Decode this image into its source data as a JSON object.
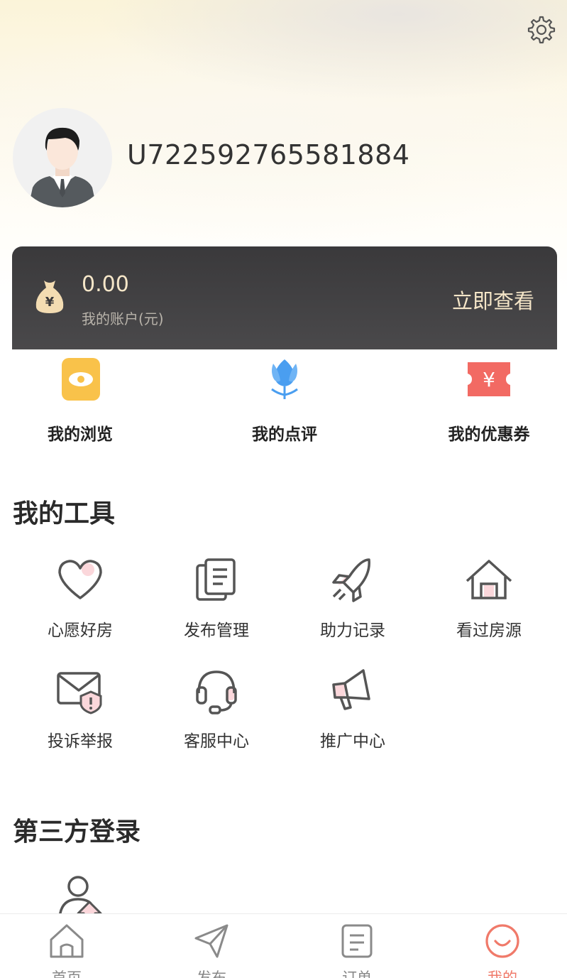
{
  "header": {
    "settings_icon": "gear-icon",
    "username": "U722592765581884"
  },
  "wallet": {
    "icon": "money-bag-icon",
    "amount": "0.00",
    "label": "我的账户(元)",
    "action": "立即查看"
  },
  "quick_links": [
    {
      "label": "我的浏览",
      "icon": "eye-icon",
      "color": "#f9c24a"
    },
    {
      "label": "我的点评",
      "icon": "tulip-icon",
      "color": "#4a9ef0"
    },
    {
      "label": "我的优惠券",
      "icon": "coupon-yen-icon",
      "color": "#f26a63"
    }
  ],
  "tools": {
    "title": "我的工具",
    "items": [
      {
        "label": "心愿好房",
        "icon": "heart-icon"
      },
      {
        "label": "发布管理",
        "icon": "documents-icon"
      },
      {
        "label": "助力记录",
        "icon": "rocket-icon"
      },
      {
        "label": "看过房源",
        "icon": "house-icon"
      },
      {
        "label": "投诉举报",
        "icon": "mail-warning-icon"
      },
      {
        "label": "客服中心",
        "icon": "headset-icon"
      },
      {
        "label": "推广中心",
        "icon": "megaphone-icon"
      }
    ]
  },
  "third_party": {
    "title": "第三方登录",
    "icon": "user-upload-icon"
  },
  "tabbar": {
    "items": [
      {
        "label": "首页",
        "icon": "home-icon"
      },
      {
        "label": "发布",
        "icon": "paper-plane-icon"
      },
      {
        "label": "订单",
        "icon": "order-icon"
      },
      {
        "label": "我的",
        "icon": "smile-icon",
        "active": true
      }
    ],
    "accent": "#f07a6a"
  }
}
